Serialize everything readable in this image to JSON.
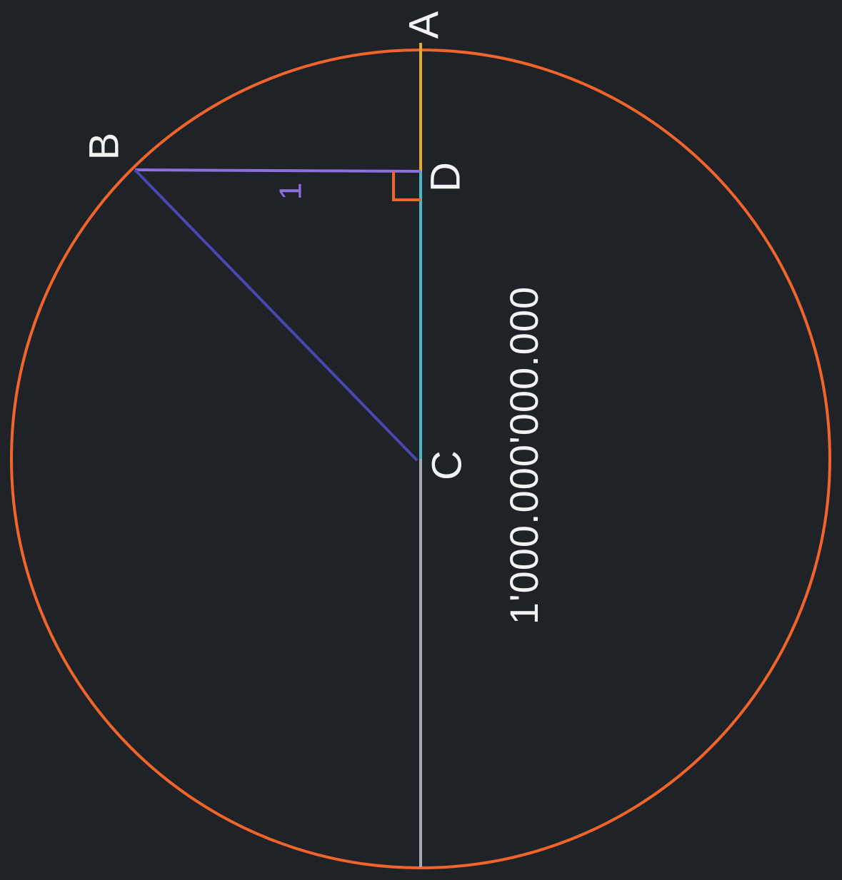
{
  "colors": {
    "background": "#1f2328",
    "circle": "#f2652a",
    "segment_ad": "#e3ab2a",
    "segment_dc": "#4bb6c4",
    "segment_c_bottom": "#a4abb5",
    "segment_bd": "#8e6fe0",
    "segment_bc": "#4a48b0",
    "right_angle": "#f2652a",
    "label": "#f2f2f2",
    "small_label": "#8e6fe0"
  },
  "labels": {
    "point_a": "A",
    "point_b": "B",
    "point_c": "C",
    "point_d": "D",
    "bd_length": "1",
    "diameter_length": "1'000.000'000.000"
  }
}
